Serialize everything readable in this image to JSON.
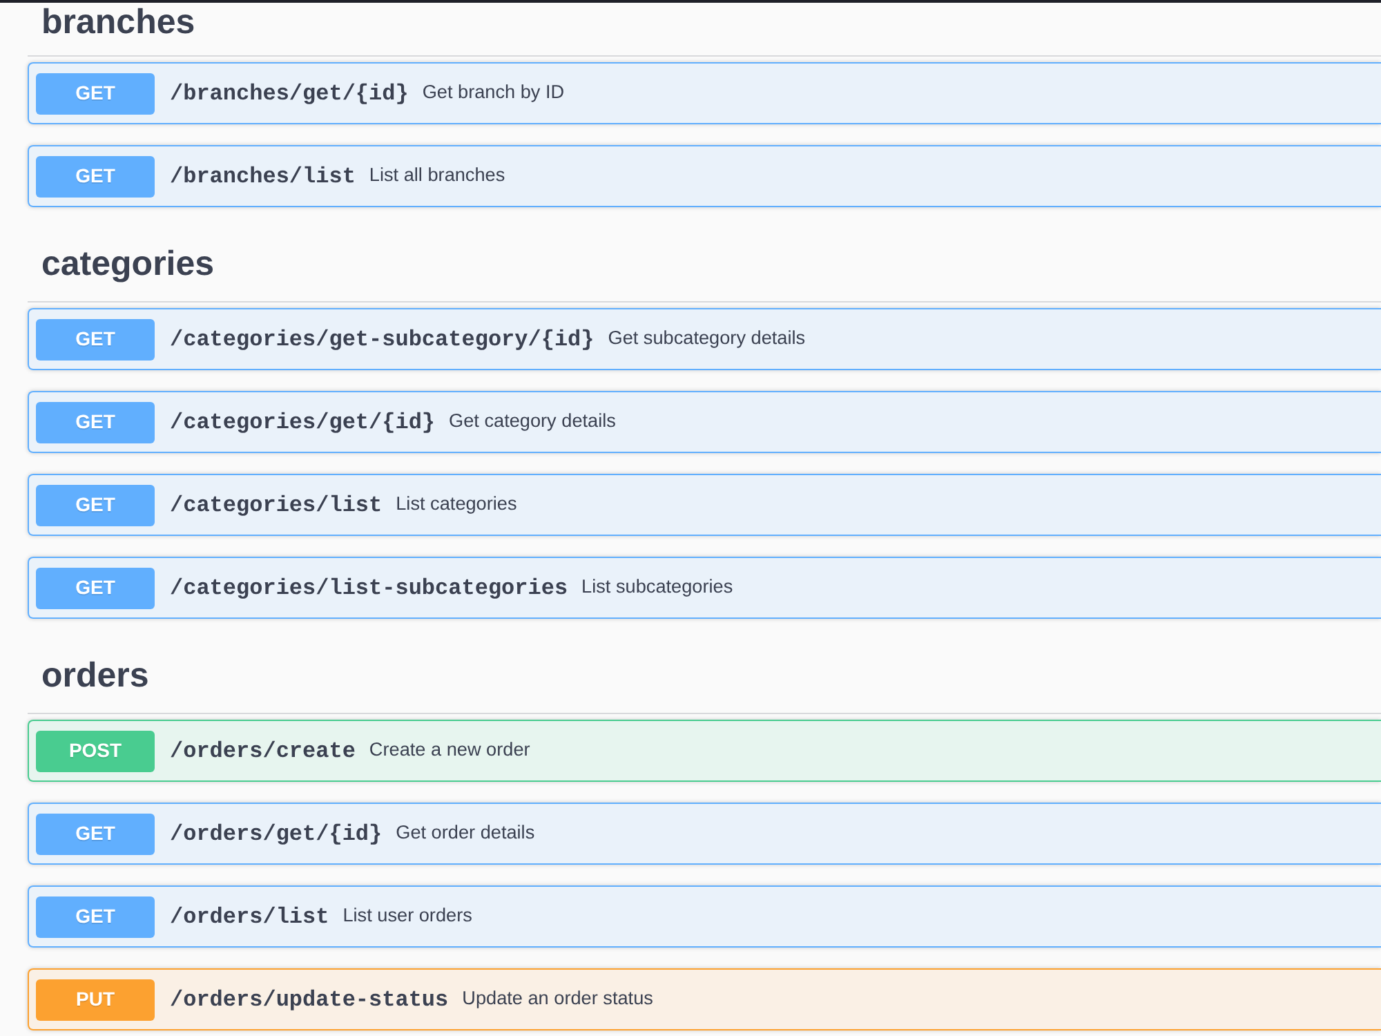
{
  "sections": [
    {
      "name": "branches",
      "operations": [
        {
          "method": "GET",
          "color": "#61affe",
          "path": "/branches/get/{id}",
          "summary": "Get branch by ID"
        },
        {
          "method": "GET",
          "color": "#61affe",
          "path": "/branches/list",
          "summary": "List all branches"
        }
      ]
    },
    {
      "name": "categories",
      "operations": [
        {
          "method": "GET",
          "color": "#61affe",
          "path": "/categories/get-subcategory/{id}",
          "summary": "Get subcategory details"
        },
        {
          "method": "GET",
          "color": "#61affe",
          "path": "/categories/get/{id}",
          "summary": "Get category details"
        },
        {
          "method": "GET",
          "color": "#61affe",
          "path": "/categories/list",
          "summary": "List categories"
        },
        {
          "method": "GET",
          "color": "#61affe",
          "path": "/categories/list-subcategories",
          "summary": "List subcategories"
        }
      ]
    },
    {
      "name": "orders",
      "operations": [
        {
          "method": "POST",
          "color": "#49cc90",
          "path": "/orders/create",
          "summary": "Create a new order"
        },
        {
          "method": "GET",
          "color": "#61affe",
          "path": "/orders/get/{id}",
          "summary": "Get order details"
        },
        {
          "method": "GET",
          "color": "#61affe",
          "path": "/orders/list",
          "summary": "List user orders"
        },
        {
          "method": "PUT",
          "color": "#fca130",
          "path": "/orders/update-status",
          "summary": "Update an order status"
        }
      ]
    }
  ]
}
